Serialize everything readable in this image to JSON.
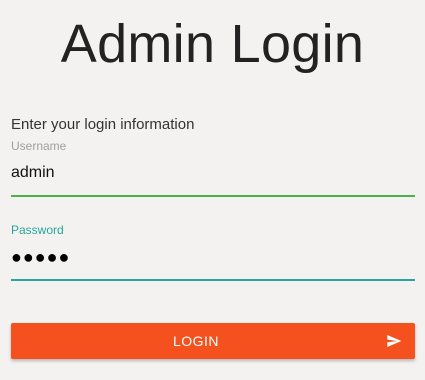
{
  "page": {
    "title": "Admin Login",
    "subtitle": "Enter your login information"
  },
  "form": {
    "username": {
      "label": "Username",
      "value": "admin",
      "underline_color": "#4caf50"
    },
    "password": {
      "label": "Password",
      "masked_value": "●●●●●",
      "accent_color": "#26a69a"
    },
    "submit": {
      "label": "LOGIN",
      "icon": "send-icon",
      "color": "#f4511e"
    }
  }
}
